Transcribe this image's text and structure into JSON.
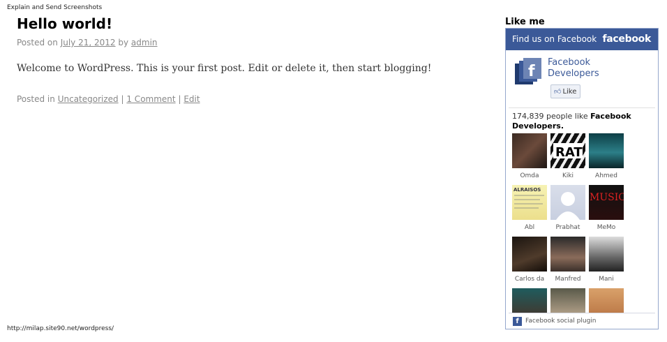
{
  "browser": {
    "title": "Explain and Send Screenshots",
    "status_url": "http://milap.site90.net/wordpress/"
  },
  "post": {
    "title": "Hello world!",
    "posted_on_label": "Posted on",
    "date": "July 21, 2012",
    "by_label": "by",
    "author": "admin",
    "body": "Welcome to WordPress. This is your first post. Edit or delete it, then start blogging!",
    "posted_in_label": "Posted in",
    "category": "Uncategorized",
    "sep1": "|",
    "comments": "1 Comment",
    "sep2": "|",
    "edit": "Edit"
  },
  "widget": {
    "title": "Like me",
    "header_text": "Find us on Facebook",
    "brand": "facebook",
    "page_name": "Facebook Developers",
    "like_label": "Like",
    "count_text": "174,839 people like",
    "count_page": "Facebook Developers",
    "count_suffix": ".",
    "fans": [
      {
        "name": "Omda"
      },
      {
        "name": "Kiki"
      },
      {
        "name": "Ahmed"
      },
      {
        "name": "Abl"
      },
      {
        "name": "Prabhat"
      },
      {
        "name": "MeMo"
      },
      {
        "name": "Carlos da"
      },
      {
        "name": "Manfred"
      },
      {
        "name": "Mani"
      },
      {
        "name": ""
      },
      {
        "name": ""
      },
      {
        "name": ""
      }
    ],
    "fan_overlays": {
      "kiki": "RAT",
      "abl": "ALRAISOS",
      "memo": "MUSIC"
    },
    "footer_text": "Facebook social plugin",
    "colors": {
      "facebook_blue": "#3b5998",
      "border": "#95a7cc"
    }
  }
}
